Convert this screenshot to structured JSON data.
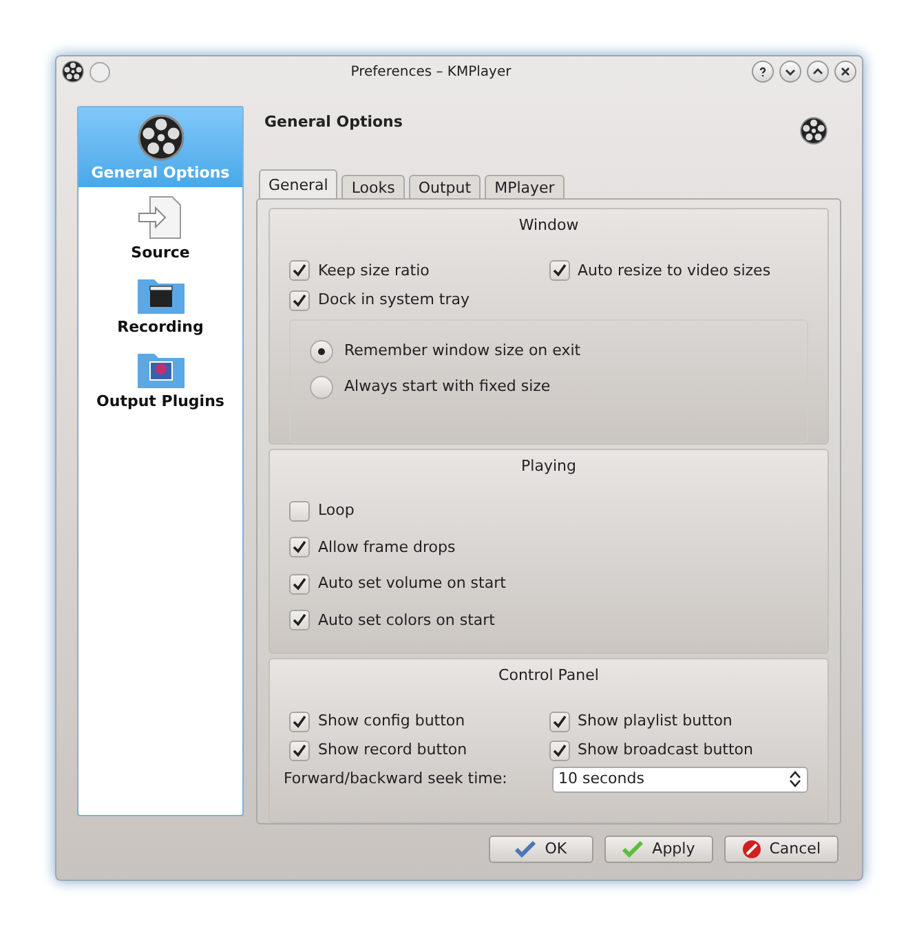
{
  "window": {
    "title": "Preferences – KMPlayer"
  },
  "sidebar": {
    "items": [
      {
        "label": "General Options",
        "kind": "reel",
        "selected": true
      },
      {
        "label": "Source",
        "kind": "source",
        "selected": false
      },
      {
        "label": "Recording",
        "kind": "recording",
        "selected": false
      },
      {
        "label": "Output Plugins",
        "kind": "plugins",
        "selected": false
      }
    ]
  },
  "header": {
    "title": "General Options"
  },
  "tabs": [
    {
      "label": "General",
      "selected": true
    },
    {
      "label": "Looks",
      "selected": false
    },
    {
      "label": "Output",
      "selected": false
    },
    {
      "label": "MPlayer",
      "selected": false
    }
  ],
  "groups": [
    {
      "title": "Window",
      "kind": "two_column",
      "checkboxes": [
        {
          "label": "Keep size ratio",
          "checked": true
        },
        {
          "label": "Auto resize to video sizes",
          "checked": true
        },
        {
          "label": "Dock in system tray",
          "checked": true
        }
      ],
      "radios": [
        {
          "label": "Remember window size on exit",
          "selected": true
        },
        {
          "label": "Always start with fixed size",
          "selected": false
        }
      ]
    },
    {
      "title": "Playing",
      "kind": "one_column",
      "checkboxes": [
        {
          "label": "Loop",
          "checked": false
        },
        {
          "label": "Allow frame drops",
          "checked": true
        },
        {
          "label": "Auto set volume on start",
          "checked": true
        },
        {
          "label": "Auto set colors on start",
          "checked": true
        }
      ]
    },
    {
      "title": "Control Panel",
      "kind": "two_column",
      "checkboxes": [
        {
          "label": "Show config button",
          "checked": true
        },
        {
          "label": "Show playlist button",
          "checked": true
        },
        {
          "label": "Show record button",
          "checked": true
        },
        {
          "label": "Show broadcast button",
          "checked": true
        }
      ],
      "seek": {
        "label": "Forward/backward seek time:",
        "value": "10 seconds"
      }
    }
  ],
  "buttons": [
    {
      "label": "OK",
      "kind": "ok"
    },
    {
      "label": "Apply",
      "kind": "apply"
    },
    {
      "label": "Cancel",
      "kind": "cancel"
    }
  ]
}
